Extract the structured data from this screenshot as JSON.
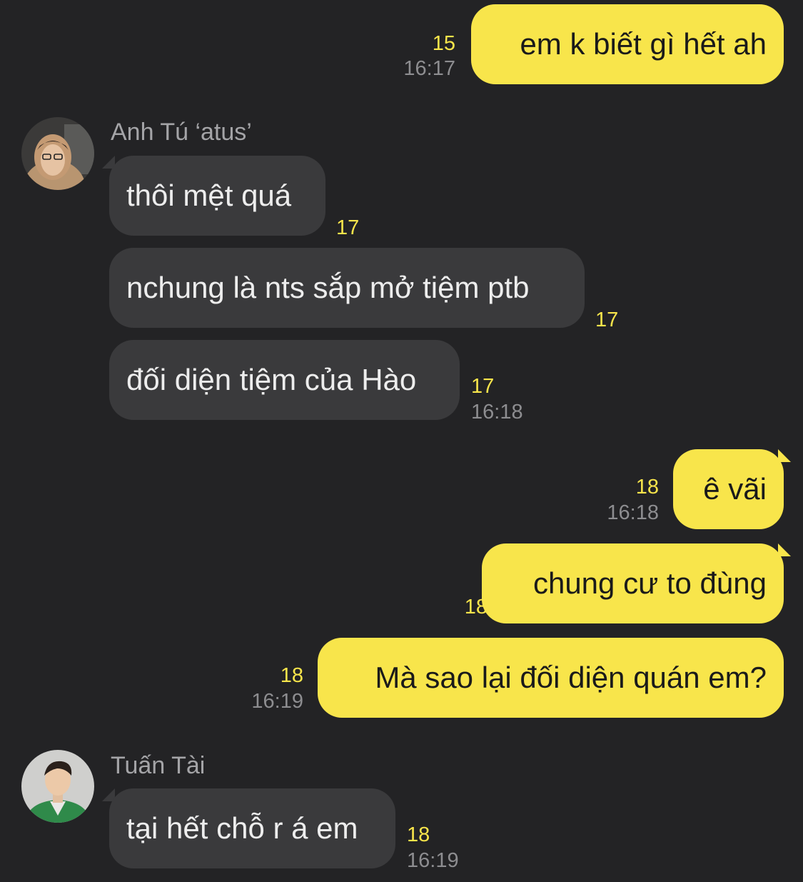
{
  "colors": {
    "background": "#232325",
    "my_bubble": "#f8e54b",
    "their_bubble": "#3a3a3c",
    "unread_count": "#f8e54b",
    "timestamp": "#8d8d90",
    "sender_name": "#a4a4a7"
  },
  "messages": [
    {
      "text": "em k biết gì hết ah",
      "unread": "15",
      "time": "16:17",
      "sender": "me"
    },
    {
      "sender_name": "Anh Tú ‘atus’",
      "avatar": "anh-tu-avatar"
    },
    {
      "text": "thôi mệt quá",
      "unread": "17",
      "sender": "them"
    },
    {
      "text": "nchung là nts sắp mở tiệm ptb",
      "unread": "17",
      "sender": "them"
    },
    {
      "text": "đối diện tiệm của Hào",
      "unread": "17",
      "time": "16:18",
      "sender": "them"
    },
    {
      "text": "ê vãi",
      "unread": "18",
      "time": "16:18",
      "sender": "me"
    },
    {
      "text": "chung cư to đùng",
      "unread": "18",
      "sender": "me"
    },
    {
      "text": "Mà sao lại đối diện quán em?",
      "unread": "18",
      "time": "16:19",
      "sender": "me"
    },
    {
      "sender_name": "Tuấn Tài",
      "avatar": "tuan-tai-avatar"
    },
    {
      "text": "tại hết chỗ r á em",
      "unread": "18",
      "time": "16:19",
      "sender": "them"
    }
  ]
}
